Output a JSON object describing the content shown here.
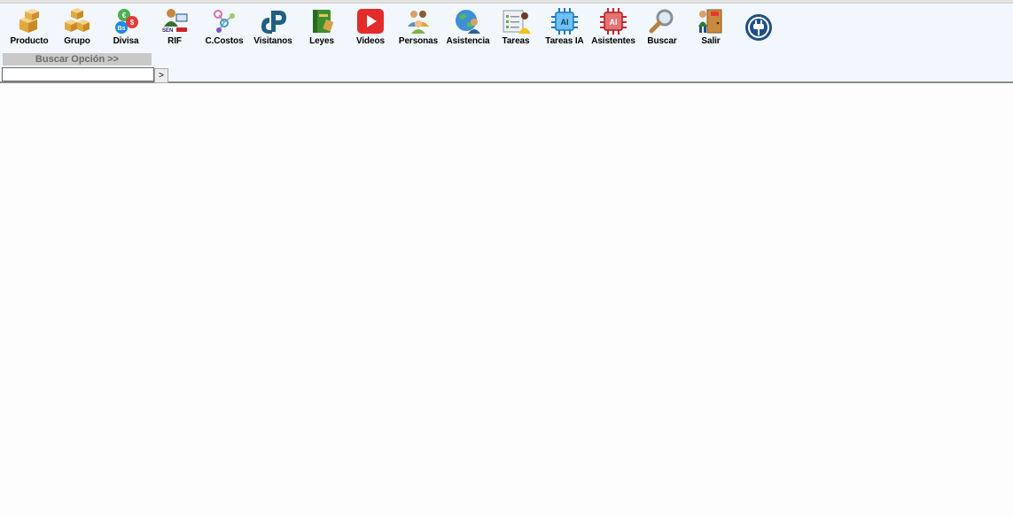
{
  "toolbar": {
    "items": [
      {
        "label": "Producto",
        "icon": "boxes-icon"
      },
      {
        "label": "Grupo",
        "icon": "boxes-group-icon"
      },
      {
        "label": "Divisa",
        "icon": "currency-icon"
      },
      {
        "label": "RIF",
        "icon": "seniat-person-icon"
      },
      {
        "label": "C.Costos",
        "icon": "cost-center-icon"
      },
      {
        "label": "Visitanos",
        "icon": "web-logo-icon"
      },
      {
        "label": "Leyes",
        "icon": "law-book-icon"
      },
      {
        "label": "Videos",
        "icon": "video-play-icon"
      },
      {
        "label": "Personas",
        "icon": "people-icon"
      },
      {
        "label": "Asistencia",
        "icon": "globe-user-icon"
      },
      {
        "label": "Tareas",
        "icon": "task-list-icon"
      },
      {
        "label": "Tareas IA",
        "icon": "ai-chip-blue-icon"
      },
      {
        "label": "Asistentes",
        "icon": "ai-chip-red-icon"
      },
      {
        "label": "Buscar",
        "icon": "magnifier-icon"
      },
      {
        "label": "Salir",
        "icon": "exit-door-icon"
      }
    ],
    "power_icon": "power-plug-icon"
  },
  "search": {
    "title": "Buscar Opción >>",
    "value": "",
    "button_label": ">"
  }
}
